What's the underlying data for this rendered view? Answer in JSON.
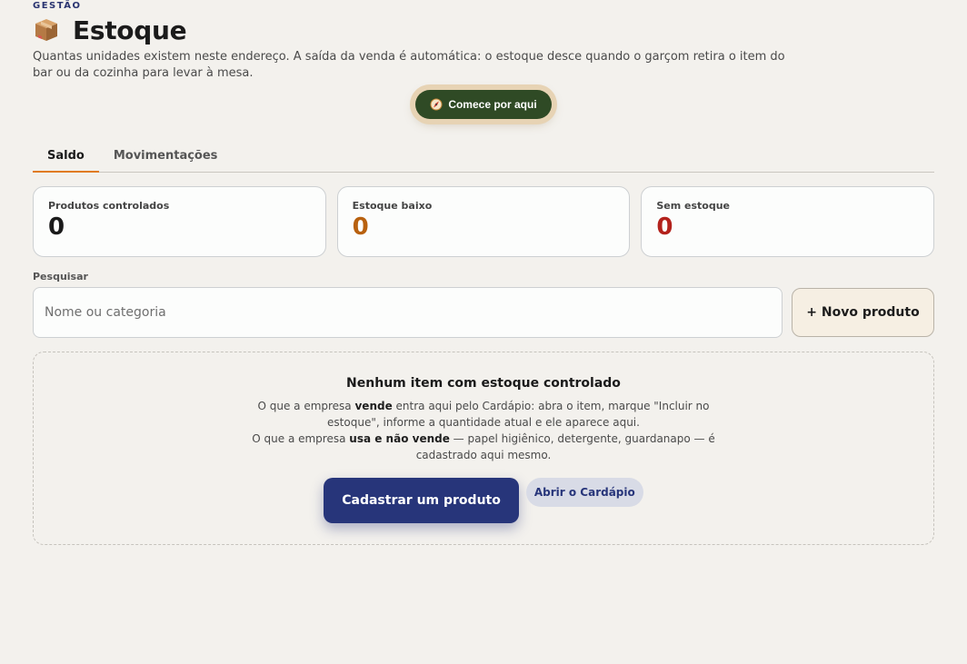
{
  "header": {
    "section": "GESTÃO",
    "title": "Estoque",
    "description": "Quantas unidades existem neste endereço. A saída da venda é automática: o estoque desce quando o garçom retira o item do bar ou da cozinha para levar à mesa.",
    "icon": "package-icon"
  },
  "start_button": {
    "label": "Comece por aqui",
    "icon": "compass-icon"
  },
  "tabs": [
    {
      "label": "Saldo",
      "active": true
    },
    {
      "label": "Movimentações",
      "active": false
    }
  ],
  "stats": [
    {
      "label": "Produtos controlados",
      "value": "0",
      "color": "#1a1a1a"
    },
    {
      "label": "Estoque baixo",
      "value": "0",
      "color": "#b8610f"
    },
    {
      "label": "Sem estoque",
      "value": "0",
      "color": "#b3221c"
    }
  ],
  "search": {
    "label": "Pesquisar",
    "placeholder": "Nome ou categoria",
    "value": ""
  },
  "new_product_button": "+ Novo produto",
  "empty_state": {
    "title": "Nenhum item com estoque controlado",
    "p1_a": "O que a empresa ",
    "p1_b": "vende",
    "p1_c": " entra aqui pelo Cardápio: abra o item, marque \"Incluir no estoque\", informe a quantidade atual e ele aparece aqui.",
    "p2_a": "O que a empresa ",
    "p2_b": "usa e não vende",
    "p2_c": " — papel higiênico, detergente, guardanapo — é cadastrado aqui mesmo.",
    "primary_button": "Cadastrar um produto",
    "secondary_button": "Abrir o Cardápio"
  },
  "colors": {
    "accent_tab": "#e07b22",
    "start_button_bg": "#2f4a25",
    "primary_button_bg": "#27357a"
  }
}
